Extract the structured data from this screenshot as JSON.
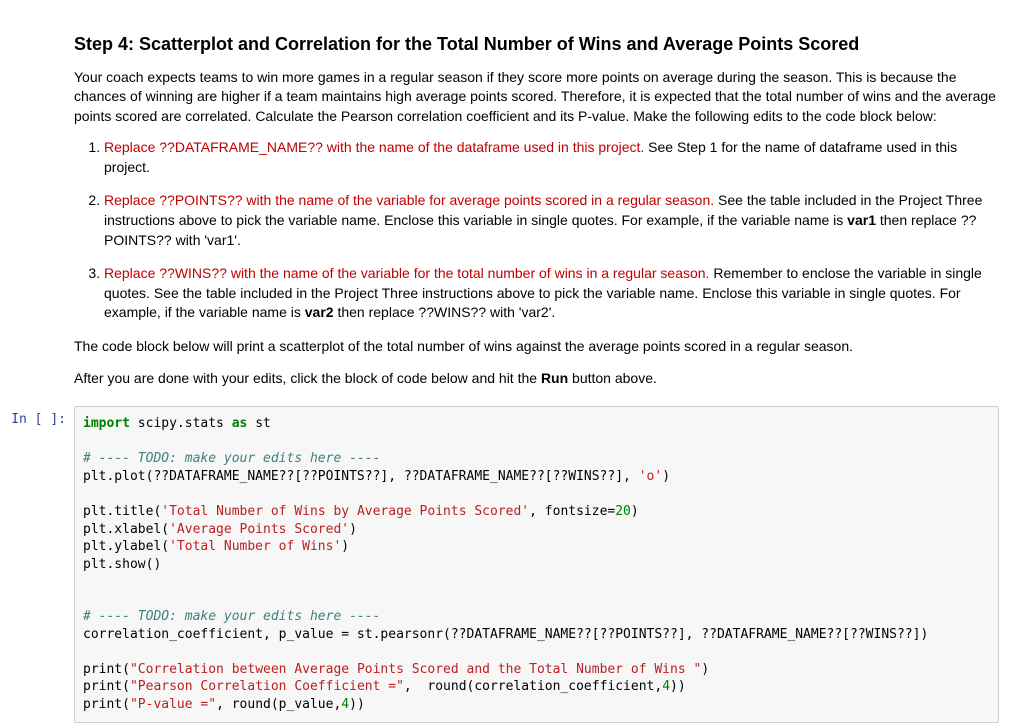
{
  "markdown": {
    "heading": "Step 4: Scatterplot and Correlation for the Total Number of Wins and Average Points Scored",
    "intro": "Your coach expects teams to win more games in a regular season if they score more points on average during the season. This is because the chances of winning are higher if a team maintains high average points scored. Therefore, it is expected that the total number of wins and the average points scored are correlated. Calculate the Pearson correlation coefficient and its P-value. Make the following edits to the code block below:",
    "li1_red": "Replace ??DATAFRAME_NAME?? with the name of the dataframe used in this project.",
    "li1_rest": " See Step 1 for the name of dataframe used in this project.",
    "li2_red": "Replace ??POINTS?? with the name of the variable for average points scored in a regular season.",
    "li2_rest_a": " See the table included in the Project Three instructions above to pick the variable name. Enclose this variable in single quotes. For example, if the variable name is ",
    "li2_bold": "var1",
    "li2_rest_b": " then replace ??POINTS?? with 'var1'.",
    "li3_red": "Replace ??WINS?? with the name of the variable for the total number of wins in a regular season.",
    "li3_rest_a": " Remember to enclose the variable in single quotes. See the table included in the Project Three instructions above to pick the variable name. Enclose this variable in single quotes. For example, if the variable name is ",
    "li3_bold": "var2",
    "li3_rest_b": " then replace ??WINS?? with 'var2'.",
    "after1": "The code block below will print a scatterplot of the total number of wins against the average points scored in a regular season.",
    "after2_a": "After you are done with your edits, click the block of code below and hit the ",
    "after2_bold": "Run",
    "after2_b": " button above."
  },
  "code": {
    "prompt": "In [ ]:",
    "l01_kw_import": "import",
    "l01_mod": " scipy.stats ",
    "l01_kw_as": "as",
    "l01_alias": " st",
    "l03_cm": "# ---- TODO: make your edits here ----",
    "l04_a": "plt.plot(??DATAFRAME_NAME??[??POINTS??], ??DATAFRAME_NAME??[??WINS??], ",
    "l04_s": "'o'",
    "l04_b": ")",
    "l06_a": "plt.title(",
    "l06_s": "'Total Number of Wins by Average Points Scored'",
    "l06_b": ", fontsize=",
    "l06_n": "20",
    "l06_c": ")",
    "l07_a": "plt.xlabel(",
    "l07_s": "'Average Points Scored'",
    "l07_b": ")",
    "l08_a": "plt.ylabel(",
    "l08_s": "'Total Number of Wins'",
    "l08_b": ")",
    "l09": "plt.show()",
    "l12_cm": "# ---- TODO: make your edits here ----",
    "l13": "correlation_coefficient, p_value = st.pearsonr(??DATAFRAME_NAME??[??POINTS??], ??DATAFRAME_NAME??[??WINS??])",
    "l15_a": "print(",
    "l15_s": "\"Correlation between Average Points Scored and the Total Number of Wins \"",
    "l15_b": ")",
    "l16_a": "print(",
    "l16_s": "\"Pearson Correlation Coefficient =\"",
    "l16_b": ",  round(correlation_coefficient,",
    "l16_n": "4",
    "l16_c": "))",
    "l17_a": "print(",
    "l17_s": "\"P-value =\"",
    "l17_b": ", round(p_value,",
    "l17_n": "4",
    "l17_c": "))"
  }
}
